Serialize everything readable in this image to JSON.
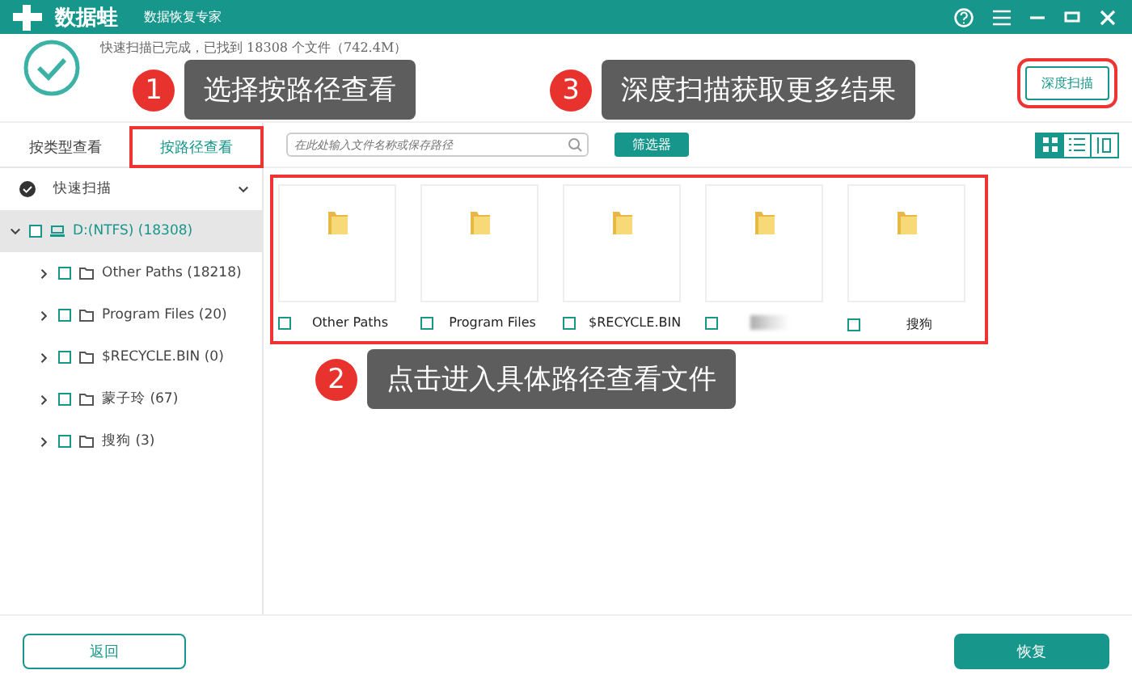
{
  "app": {
    "name": "数据蛙",
    "subtitle": "数据恢复专家"
  },
  "scan_status": {
    "message": "快速扫描已完成，已找到 18308 个文件（742.4M）"
  },
  "deep_scan_button": "深度扫描",
  "tabs": [
    {
      "label": "按类型查看",
      "selected": false
    },
    {
      "label": "按路径查看",
      "selected": true
    }
  ],
  "search": {
    "placeholder": "在此处输入文件名称或保存路径"
  },
  "filter_button": "筛选器",
  "view_modes": [
    {
      "kind": "grid",
      "selected": true
    },
    {
      "kind": "list",
      "selected": false
    },
    {
      "kind": "detail",
      "selected": false
    }
  ],
  "scan_group": {
    "label": "快速扫描",
    "expanded": true
  },
  "tree": [
    {
      "label": "D:(NTFS) (18308)",
      "kind": "drive",
      "expanded": true,
      "selected": true,
      "checked": false,
      "children": [
        {
          "label": "Other Paths (18218)",
          "kind": "folder",
          "expanded": false,
          "selected": false,
          "checked": false
        },
        {
          "label": "Program Files (20)",
          "kind": "folder",
          "expanded": false,
          "selected": false,
          "checked": false
        },
        {
          "label": "$RECYCLE.BIN (0)",
          "kind": "folder",
          "expanded": false,
          "selected": false,
          "checked": false
        },
        {
          "label": "蒙子玲 (67)",
          "kind": "folder",
          "expanded": false,
          "selected": false,
          "checked": false
        },
        {
          "label": "搜狗 (3)",
          "kind": "folder",
          "expanded": false,
          "selected": false,
          "checked": false
        }
      ]
    }
  ],
  "folders": [
    {
      "name": "Other Paths",
      "checked": false,
      "redacted": false
    },
    {
      "name": "Program Files",
      "checked": false,
      "redacted": false
    },
    {
      "name": "$RECYCLE.BIN",
      "checked": false,
      "redacted": false
    },
    {
      "checked": false,
      "redacted": true
    },
    {
      "name": "搜狗",
      "checked": false,
      "redacted": false
    }
  ],
  "callouts": [
    {
      "number": "1",
      "text": "选择按路径查看"
    },
    {
      "number": "2",
      "text": "点击进入具体路径查看文件"
    },
    {
      "number": "3",
      "text": "深度扫描获取更多结果"
    }
  ],
  "footer": {
    "back_button": "返回",
    "recover_button": "恢复"
  }
}
